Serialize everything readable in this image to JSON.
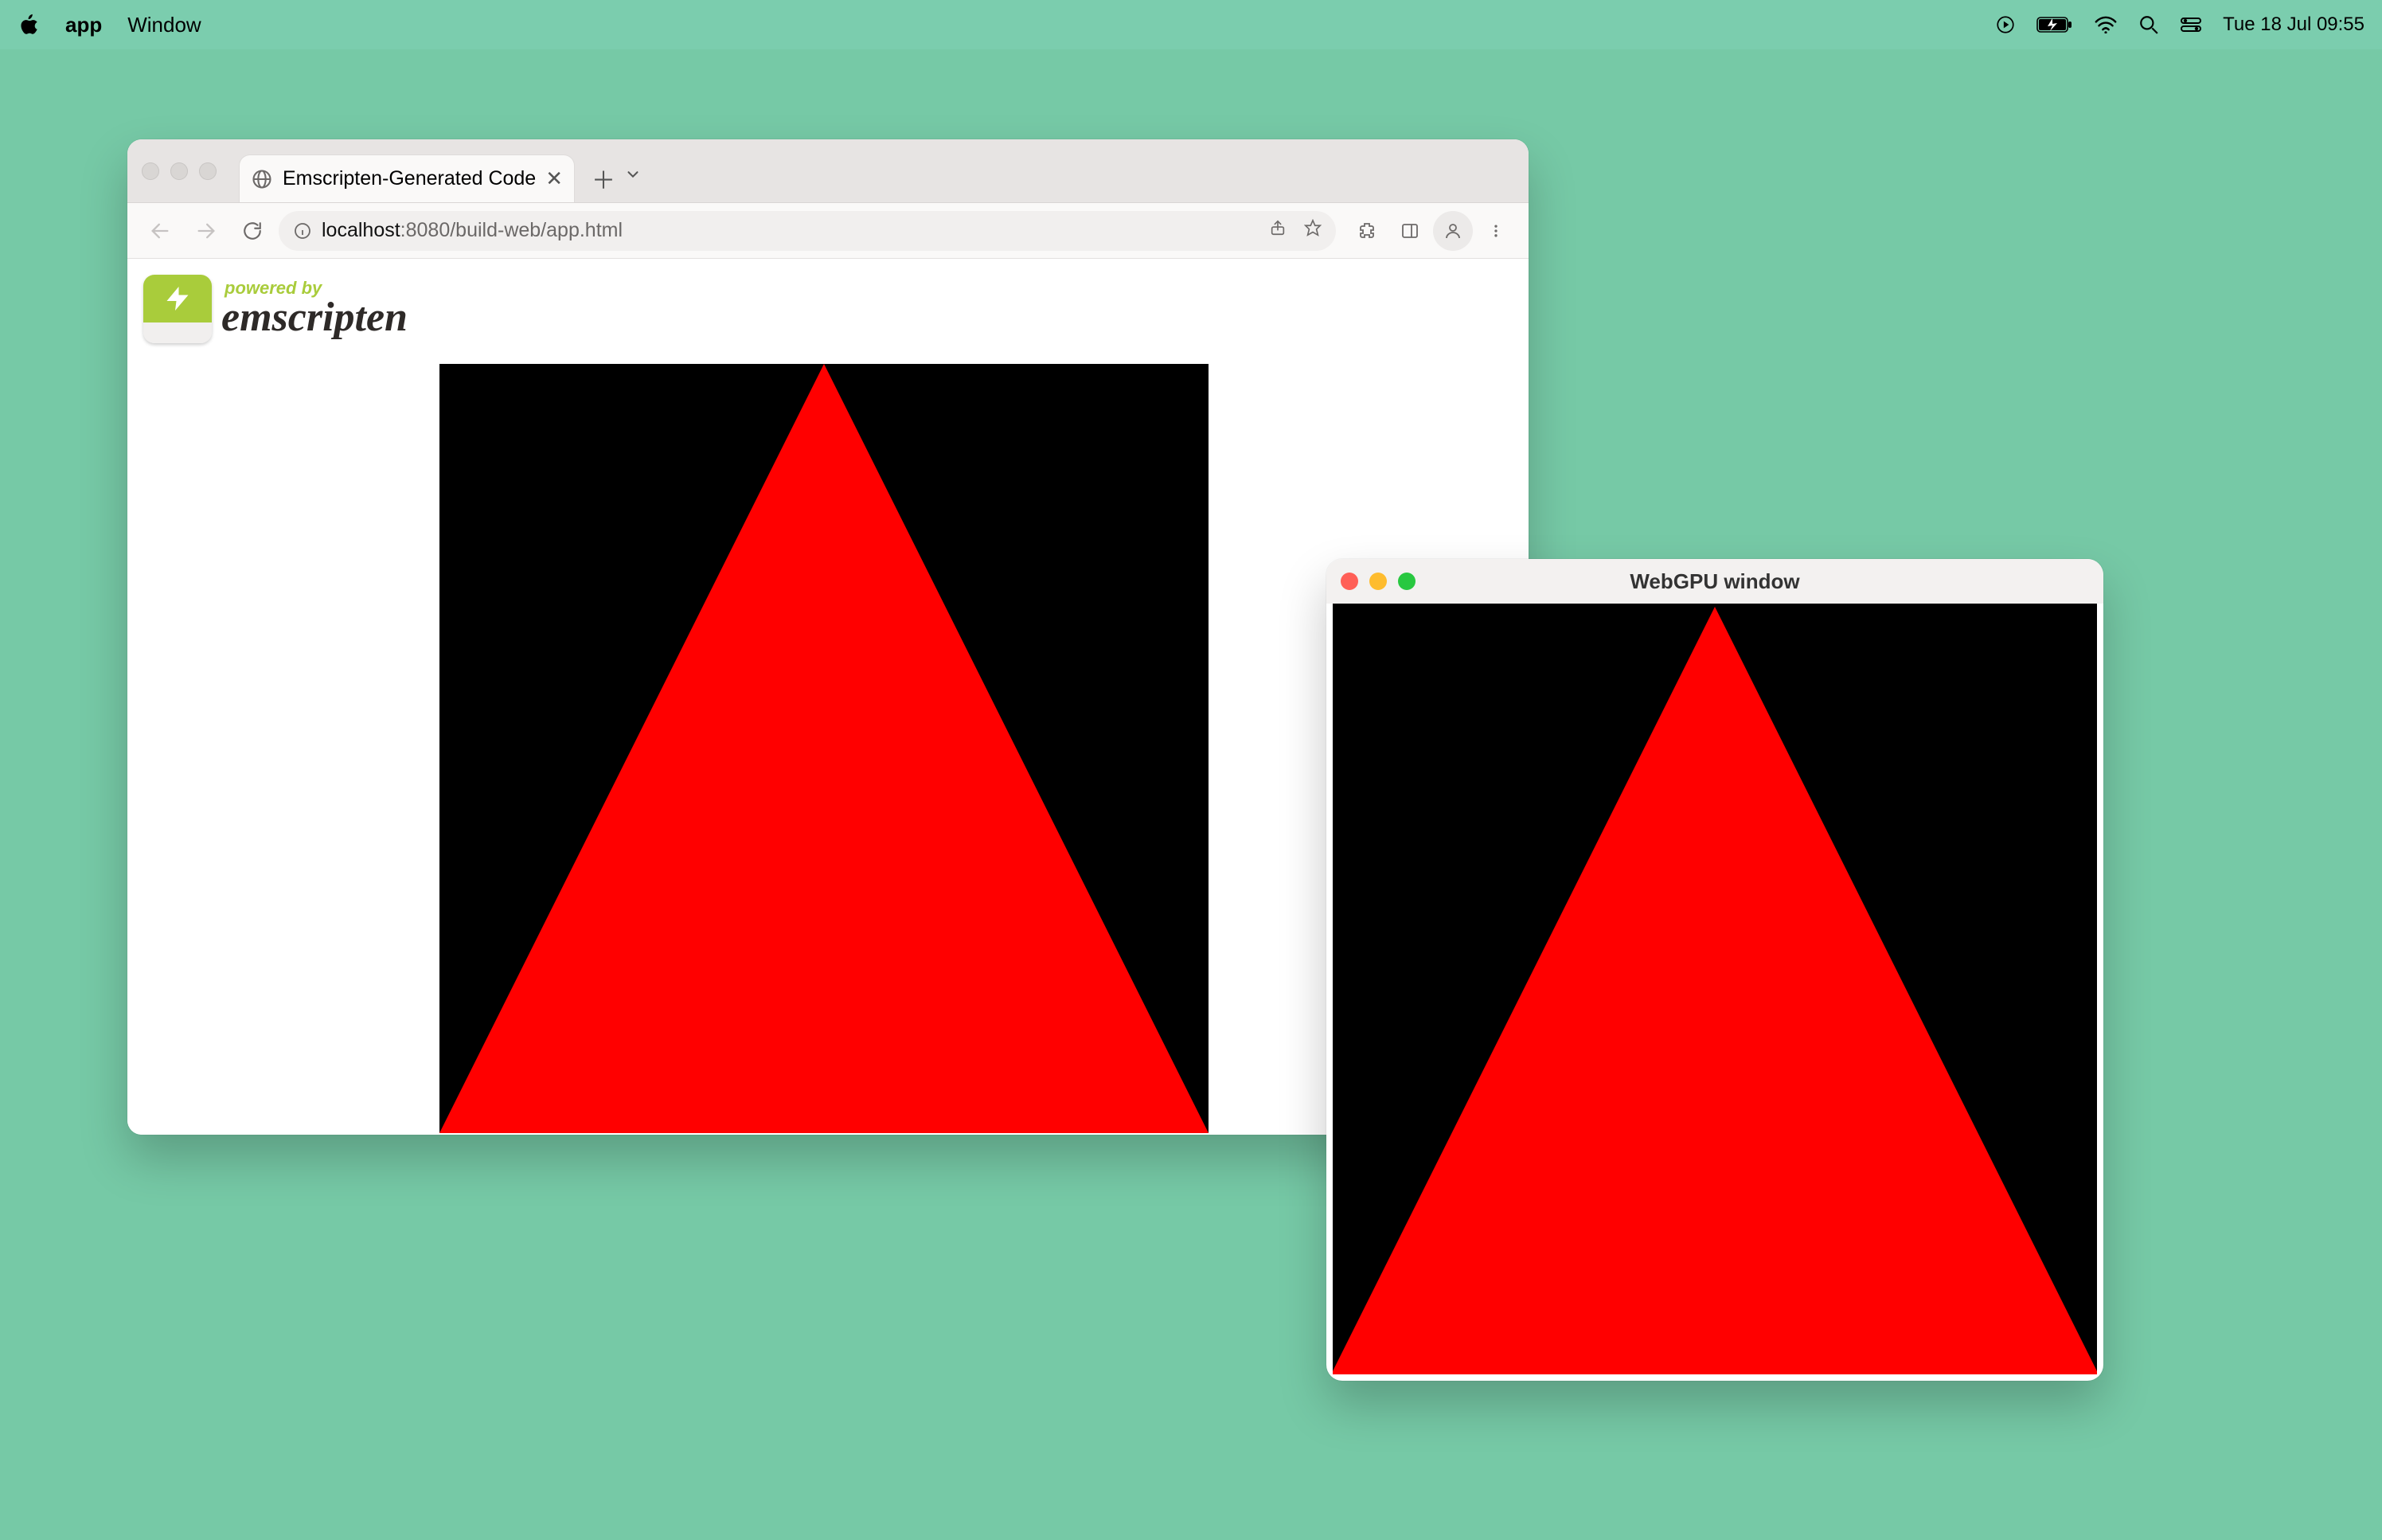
{
  "menubar": {
    "app_name": "app",
    "menu_window": "Window",
    "clock": "Tue 18 Jul  09:55"
  },
  "chrome": {
    "tab_title": "Emscripten-Generated Code",
    "url_host_prefix": "localhost",
    "url_rest": ":8080/build-web/app.html",
    "logo_small": "powered by",
    "logo_big": "emscripten",
    "canvas_bg": "#000000",
    "triangle_color": "#ff0000"
  },
  "native": {
    "title": "WebGPU window",
    "canvas_bg": "#000000",
    "triangle_color": "#ff0000"
  }
}
